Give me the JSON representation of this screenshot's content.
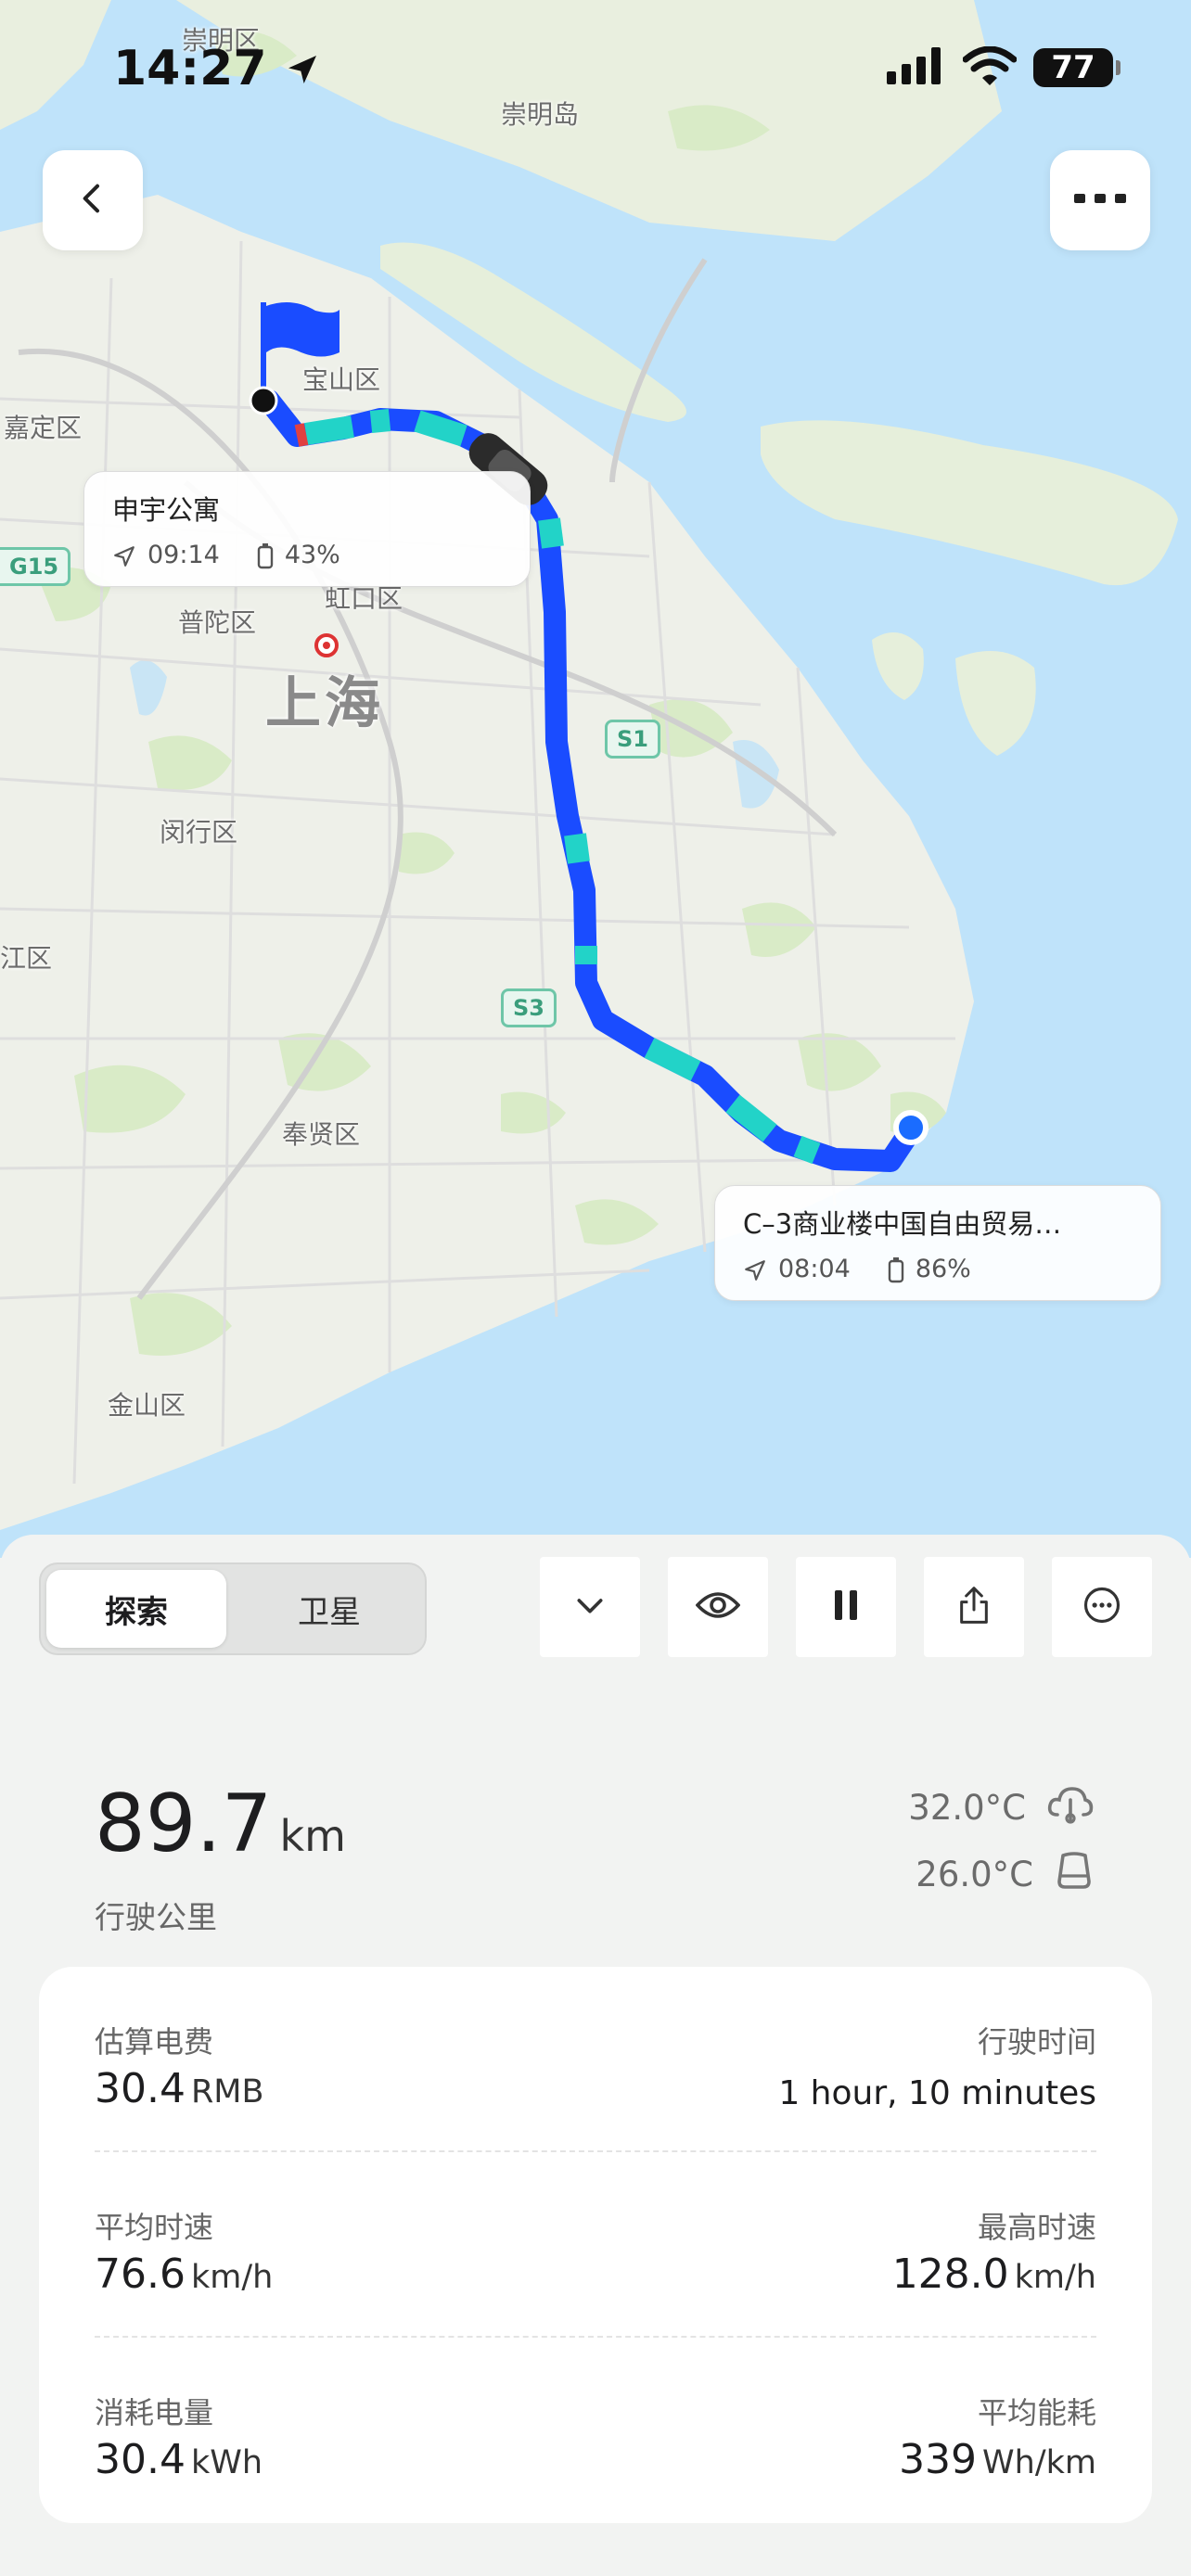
{
  "status_bar": {
    "time": "14:27",
    "battery": "77"
  },
  "map": {
    "labels": {
      "chongming_district": "崇明区",
      "chongming_island": "崇明岛",
      "baoshan": "宝山区",
      "jiading": "嘉定区",
      "hongkou": "虹口区",
      "putuo": "普陀区",
      "shanghai": "上海",
      "minhang": "闵行区",
      "jiang": "江区",
      "fengxian": "奉贤区",
      "jinshan": "金山区"
    },
    "shields": {
      "g15": "G15",
      "s1": "S1",
      "s3": "S3"
    }
  },
  "trip": {
    "end": {
      "name": "申宇公寓",
      "time": "09:14",
      "battery": "43%"
    },
    "start": {
      "name": "C–3商业楼中国自由贸易…",
      "time": "08:04",
      "battery": "86%"
    }
  },
  "controls": {
    "view_modes": [
      "探索",
      "卫星"
    ],
    "selected_view": "探索",
    "tools": [
      "chevron-down-icon",
      "eye-icon",
      "pause-icon",
      "share-icon",
      "more-circle-icon"
    ]
  },
  "summary": {
    "distance_value": "89.7",
    "distance_unit": "km",
    "distance_label": "行驶公里",
    "outside_temp": "32.0°C",
    "inside_temp": "26.0°C"
  },
  "stats": {
    "est_cost_label": "估算电费",
    "est_cost_value": "30.4",
    "est_cost_unit": "RMB",
    "drive_time_label": "行驶时间",
    "drive_time_value": "1 hour, 10 minutes",
    "avg_speed_label": "平均时速",
    "avg_speed_value": "76.6",
    "avg_speed_unit": "km/h",
    "max_speed_label": "最高时速",
    "max_speed_value": "128.0",
    "max_speed_unit": "km/h",
    "energy_label": "消耗电量",
    "energy_value": "30.4",
    "energy_unit": "kWh",
    "avg_consumption_label": "平均能耗",
    "avg_consumption_value": "339",
    "avg_consumption_unit": "Wh/km"
  },
  "colors": {
    "route_fast": "#1a4cff",
    "route_slow": "#22d3c8",
    "water": "#bfe3fa",
    "land": "#eef0e9"
  }
}
